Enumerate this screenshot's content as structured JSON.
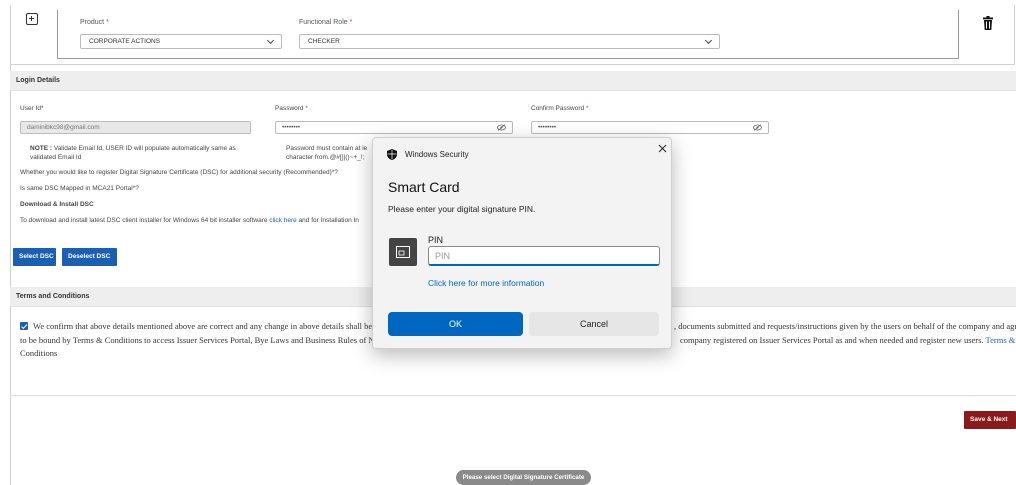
{
  "top_form": {
    "product_label": "Product",
    "product_required": "*",
    "product_value": "CORPORATE ACTIONS",
    "role_label": "Functional Role",
    "role_required": "*",
    "role_value": "CHECKER"
  },
  "login_details": {
    "header": "Login Details",
    "user_id_label": "User Id*",
    "user_id_value": "daminibkc98@gmail.com",
    "password_label": "Password",
    "password_required": "*",
    "password_value": "••••••••",
    "confirm_label": "Confirm Password",
    "confirm_required": "*",
    "confirm_value": "••••••••",
    "note_bold": "NOTE :",
    "note_line1": " Validate Email Id, USER ID will populate automatically same as",
    "note_line2": "validated Email Id",
    "pwd_rule_line1": "Password must contain at le",
    "pwd_rule_line2": "character from.@#[]|()~+_!;",
    "dsc_question": "Whether you would like to register Digital Signature Certificate (DSC) for additional security (Recommended)*?",
    "mca_question": "Is same DSC Mapped in MCA21 Portal*?",
    "download_heading": "Download & Install DSC",
    "download_text": "To download and install latest DSC client installer for Windows 64 bit installer software ",
    "click_here": "click here",
    "download_text2": " and for Installation In",
    "select_dsc": "Select DSC",
    "deselect_dsc": "Deselect DSC"
  },
  "terms": {
    "header": "Terms and Conditions",
    "line1_left": "We confirm that above details mentioned above are correct and any change in above details shall be i",
    "line1_right": ", documents submitted and requests/instructions given by the users on behalf of the company and agre",
    "line2_left": "to be bound by Terms & Conditions to access Issuer Services Portal, Bye Laws and Business Rules of N",
    "line2_right": "company registered on Issuer Services Portal as and when needed and register new users. ",
    "terms_link_1": "Terms &",
    "terms_link_2": "Conditions",
    "save_next": "Save & Next"
  },
  "toast": "Please select Digital Signature Certificate",
  "dialog": {
    "title": "Windows Security",
    "heading": "Smart Card",
    "subtitle": "Please enter your digital signature PIN.",
    "pin_label": "PIN",
    "pin_placeholder": "PIN",
    "more_info": "Click here for more information",
    "ok": "OK",
    "cancel": "Cancel"
  },
  "colors": {
    "accent_blue": "#1a5fb4",
    "save_red": "#8b1a1a",
    "windows_blue": "#0067c0"
  }
}
